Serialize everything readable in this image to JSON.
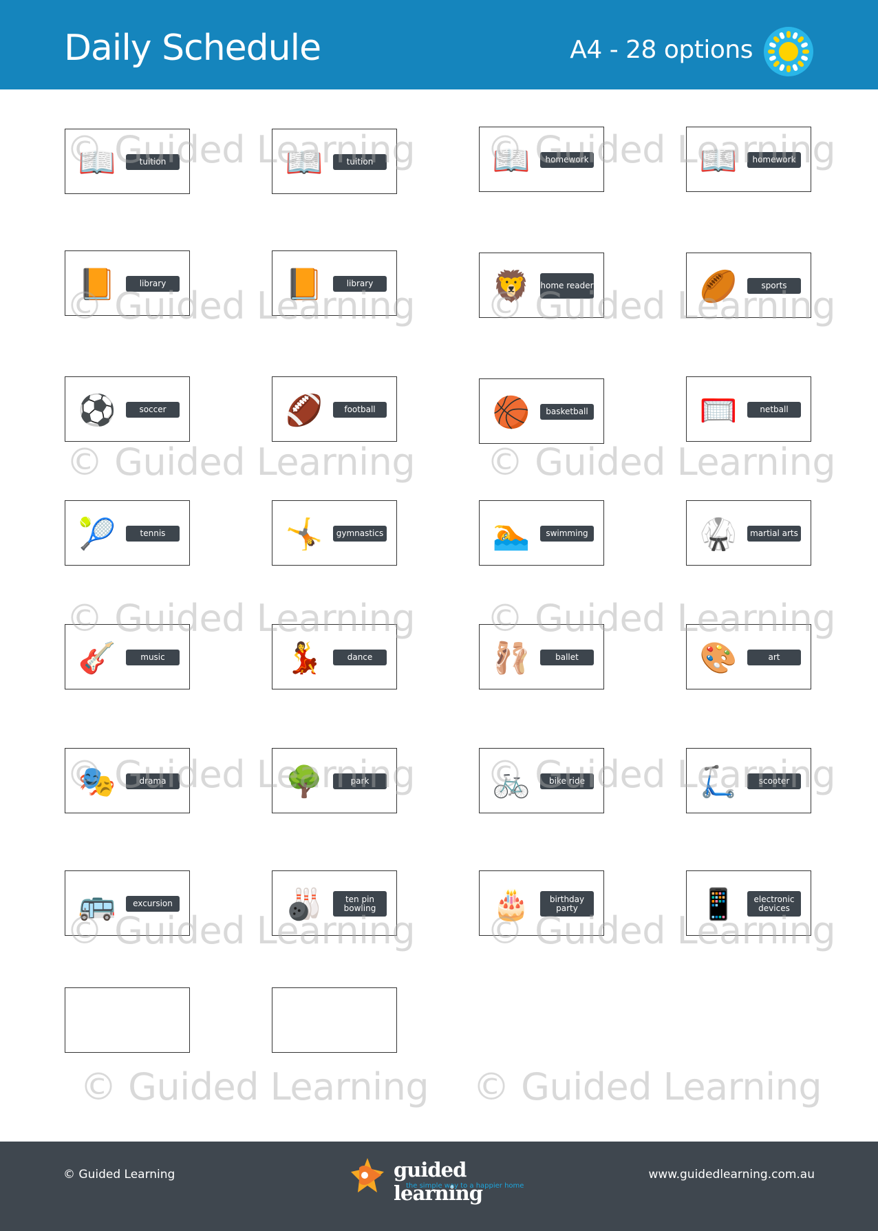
{
  "header": {
    "title": "Daily Schedule",
    "subtitle": "A4 - 28 options",
    "icon": "sun-icon",
    "background_color": "#1585bd"
  },
  "watermark_text": "© Guided Learning",
  "cards": [
    {
      "label": "tuition",
      "icon": "open-book-pen-icon",
      "glyph": "📖"
    },
    {
      "label": "tuition",
      "icon": "open-book-pen-icon",
      "glyph": "📖"
    },
    {
      "label": "homework",
      "icon": "open-book-pencil-icon",
      "glyph": "📖"
    },
    {
      "label": "homework",
      "icon": "open-book-pencil-icon",
      "glyph": "📖"
    },
    {
      "label": "library",
      "icon": "orange-book-icon",
      "glyph": "📙"
    },
    {
      "label": "library",
      "icon": "orange-book-icon",
      "glyph": "📙"
    },
    {
      "label": "home reader",
      "icon": "lion-book-icon",
      "glyph": "🦁"
    },
    {
      "label": "sports",
      "icon": "sports-balls-icon",
      "glyph": "🏉"
    },
    {
      "label": "soccer",
      "icon": "soccer-ball-icon",
      "glyph": "⚽"
    },
    {
      "label": "football",
      "icon": "football-icon",
      "glyph": "🏈"
    },
    {
      "label": "basketball",
      "icon": "basketball-hoop-icon",
      "glyph": "🏀"
    },
    {
      "label": "netball",
      "icon": "netball-hoop-icon",
      "glyph": "🥅"
    },
    {
      "label": "tennis",
      "icon": "tennis-racket-icon",
      "glyph": "🎾"
    },
    {
      "label": "gymnastics",
      "icon": "gymnast-rings-icon",
      "glyph": "🤸"
    },
    {
      "label": "swimming",
      "icon": "swimmer-icon",
      "glyph": "🏊"
    },
    {
      "label": "martial arts",
      "icon": "martial-arts-uniform-icon",
      "glyph": "🥋"
    },
    {
      "label": "music",
      "icon": "musical-instruments-icon",
      "glyph": "🎸"
    },
    {
      "label": "dance",
      "icon": "dancing-boy-icon",
      "glyph": "💃"
    },
    {
      "label": "ballet",
      "icon": "ballet-shoe-icon",
      "glyph": "🩰"
    },
    {
      "label": "art",
      "icon": "paint-palette-icon",
      "glyph": "🎨"
    },
    {
      "label": "drama",
      "icon": "theatre-masks-icon",
      "glyph": "🎭"
    },
    {
      "label": "park",
      "icon": "tree-swing-icon",
      "glyph": "🌳"
    },
    {
      "label": "bike ride",
      "icon": "bicycle-icon",
      "glyph": "🚲"
    },
    {
      "label": "scooter",
      "icon": "scooter-icon",
      "glyph": "🛴"
    },
    {
      "label": "excursion",
      "icon": "bus-icon",
      "glyph": "🚌"
    },
    {
      "label": "ten pin bowling",
      "icon": "bowling-icon",
      "glyph": "🎳"
    },
    {
      "label": "birthday party",
      "icon": "birthday-cake-icon",
      "glyph": "🎂"
    },
    {
      "label": "electronic devices",
      "icon": "devices-icon",
      "glyph": "📱"
    },
    {
      "label": "",
      "icon": "",
      "glyph": ""
    },
    {
      "label": "",
      "icon": "",
      "glyph": ""
    }
  ],
  "footer": {
    "copyright": "© Guided Learning",
    "logo_name": "guided learning",
    "logo_tagline": "the simple way to a happier home",
    "website": "www.guidedlearning.com.au",
    "background_color": "#3f474f",
    "tagline_color": "#1ca5dd"
  }
}
